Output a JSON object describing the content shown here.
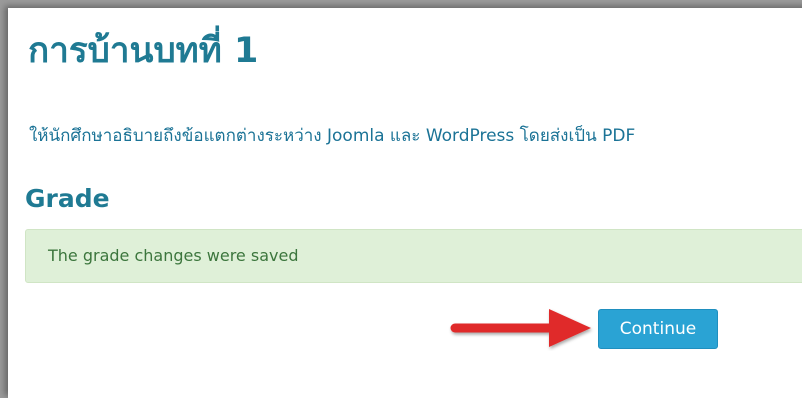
{
  "assignment": {
    "title": "การบ้านบทที่ 1",
    "description": "ให้นักศึกษาอธิบายถึงข้อแตกต่างระหว่าง Joomla และ WordPress โดยส่งเป็น PDF"
  },
  "grade": {
    "heading": "Grade",
    "alert_message": "The grade changes were saved",
    "continue_label": "Continue"
  },
  "colors": {
    "heading": "#1f7a93",
    "description_text": "#1b7396",
    "alert_background": "#dff0d8",
    "alert_text": "#3c763d",
    "button_background": "#2aa3d4",
    "annotation_arrow": "#e02a2a"
  },
  "icons": {
    "annotation": "red-arrow-icon"
  }
}
